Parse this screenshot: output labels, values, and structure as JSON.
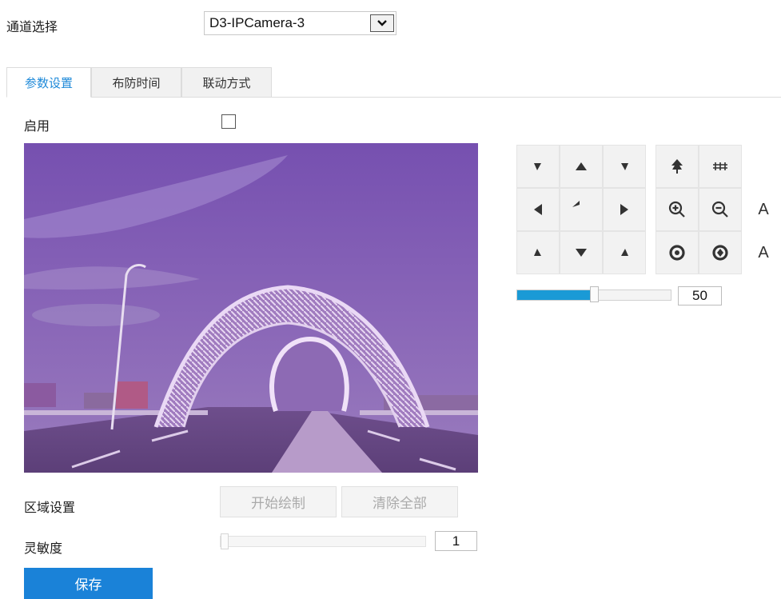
{
  "channel": {
    "label": "通道选择",
    "selected": "D3-IPCamera-3"
  },
  "tabs": [
    {
      "label": "参数设置",
      "active": true
    },
    {
      "label": "布防时间",
      "active": false
    },
    {
      "label": "联动方式",
      "active": false
    }
  ],
  "enable": {
    "label": "启用",
    "checked": false
  },
  "ptz": {
    "icons": [
      "up-left-arrow-icon",
      "up-arrow-icon",
      "up-right-arrow-icon",
      "zoom-tele-icon",
      "zoom-wide-icon",
      "left-arrow-icon",
      "return-home-icon",
      "right-arrow-icon",
      "zoom-in-icon",
      "zoom-out-icon",
      "down-left-arrow-icon",
      "down-arrow-icon",
      "down-right-arrow-icon",
      "iris-open-icon",
      "iris-close-icon"
    ],
    "auto_focus_label": "A",
    "auto_iris_label": "A",
    "speed_value": "50",
    "speed_fraction": 0.5
  },
  "region": {
    "label": "区域设置",
    "start_draw": "开始绘制",
    "clear_all": "清除全部"
  },
  "sensitivity": {
    "label": "灵敏度",
    "value": "1",
    "fraction": 0.0
  },
  "save_label": "保存"
}
